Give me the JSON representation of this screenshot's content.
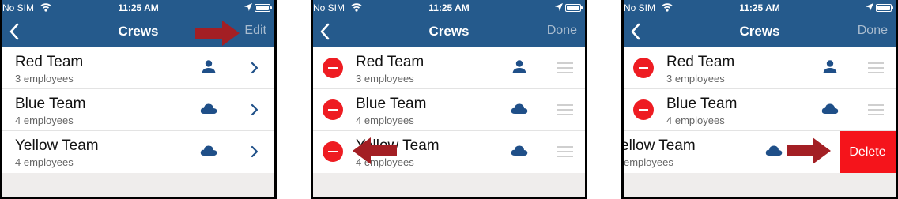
{
  "status": {
    "carrier": "No SIM",
    "time": "11:25 AM"
  },
  "colors": {
    "nav_background": "#255a8c",
    "nav_action_text": "#a9bccf",
    "icon_blue": "#1f4f88",
    "delete_red": "#ee1c22",
    "annotation_arrow": "#a31f24"
  },
  "screens": [
    {
      "mode": "normal",
      "nav": {
        "title": "Crews",
        "action": "Edit",
        "back_icon": "chevron-left-icon"
      },
      "rows": [
        {
          "name": "Red Team",
          "count": "3 employees",
          "icon": "person-icon"
        },
        {
          "name": "Blue Team",
          "count": "4 employees",
          "icon": "cloud-icon"
        },
        {
          "name": "Yellow Team",
          "count": "4 employees",
          "icon": "cloud-icon"
        }
      ],
      "annotation": "arrow-right pointing at Edit"
    },
    {
      "mode": "editing",
      "nav": {
        "title": "Crews",
        "action": "Done",
        "back_icon": "chevron-left-icon"
      },
      "rows": [
        {
          "name": "Red Team",
          "count": "3 employees",
          "icon": "person-icon"
        },
        {
          "name": "Blue Team",
          "count": "4 employees",
          "icon": "cloud-icon"
        },
        {
          "name": "Yellow Team",
          "count": "4 employees",
          "icon": "cloud-icon"
        }
      ],
      "annotation": "arrow-left pointing at delete control"
    },
    {
      "mode": "delete-revealed",
      "nav": {
        "title": "Crews",
        "action": "Done",
        "back_icon": "chevron-left-icon"
      },
      "rows": [
        {
          "name": "Red Team",
          "count": "3 employees",
          "icon": "person-icon"
        },
        {
          "name": "Blue Team",
          "count": "4 employees",
          "icon": "cloud-icon"
        },
        {
          "name": "ellow Team",
          "count": "employees",
          "icon": "cloud-icon"
        }
      ],
      "delete_label": "Delete",
      "annotation": "arrow-right pointing at Delete button"
    }
  ]
}
